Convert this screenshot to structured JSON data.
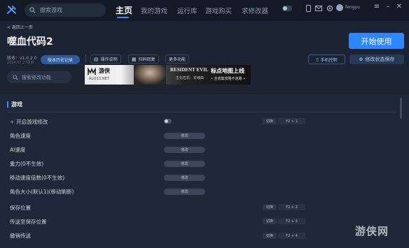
{
  "topbar": {
    "search_placeholder": "搜索游戏",
    "nav": [
      "主页",
      "我的游戏",
      "运行库",
      "游戏购买",
      "求修改器"
    ],
    "username": "fengyu",
    "colors": {
      "accent": "#3b8cff",
      "bar_bg": "#141a25"
    }
  },
  "header": {
    "back_label": "< 返回上一页",
    "title": "噬血代码2",
    "version": "版本：v1.0.2.0",
    "date": "2024.07.27更新",
    "history_label": "版本历史记录",
    "tools": [
      "操作说明",
      "扫码回复",
      "更多功能"
    ],
    "start_label": "开始使用",
    "phone_label": "手机控制",
    "save_label": "修改状态保存",
    "search_mod_placeholder": "搜索修改功能"
  },
  "banner": {
    "brand": "游侠",
    "brand_sub": "ALI213.NET",
    "game": "RESIDENT EVIL",
    "game_sub": "生化危机：安魂曲",
    "headline": "标点地图上线",
    "subline": "• 全收集攻略不迷路 •"
  },
  "section": {
    "title": "游戏"
  },
  "rows": [
    {
      "label": "开启游戏修改",
      "prefix": "+",
      "control": "toggle",
      "switch_label": "切换",
      "hotkey": "F2 + 1"
    },
    {
      "label": "角色速度",
      "control": "modify",
      "modify_label": "修改"
    },
    {
      "label": "AI速度",
      "control": "modify",
      "modify_label": "修改"
    },
    {
      "label": "重力(0不生效)",
      "control": "modify",
      "modify_label": "修改"
    },
    {
      "label": "移动速度倍数(0不生效)",
      "control": "modify",
      "modify_label": "修改"
    },
    {
      "label": "角色大小(默认1)(移动刷新)",
      "control": "modify",
      "modify_label": "修改"
    },
    {
      "label": "保存位置",
      "control": "hotkey",
      "switch_label": "切换",
      "hotkey": "F2 + 2"
    },
    {
      "label": "传送至保存位置",
      "control": "hotkey",
      "switch_label": "切换",
      "hotkey": "F2 + 3"
    },
    {
      "label": "撤销传送",
      "control": "hotkey",
      "switch_label": "切换",
      "hotkey": "F2 + 4"
    }
  ],
  "watermark": "游侠网"
}
